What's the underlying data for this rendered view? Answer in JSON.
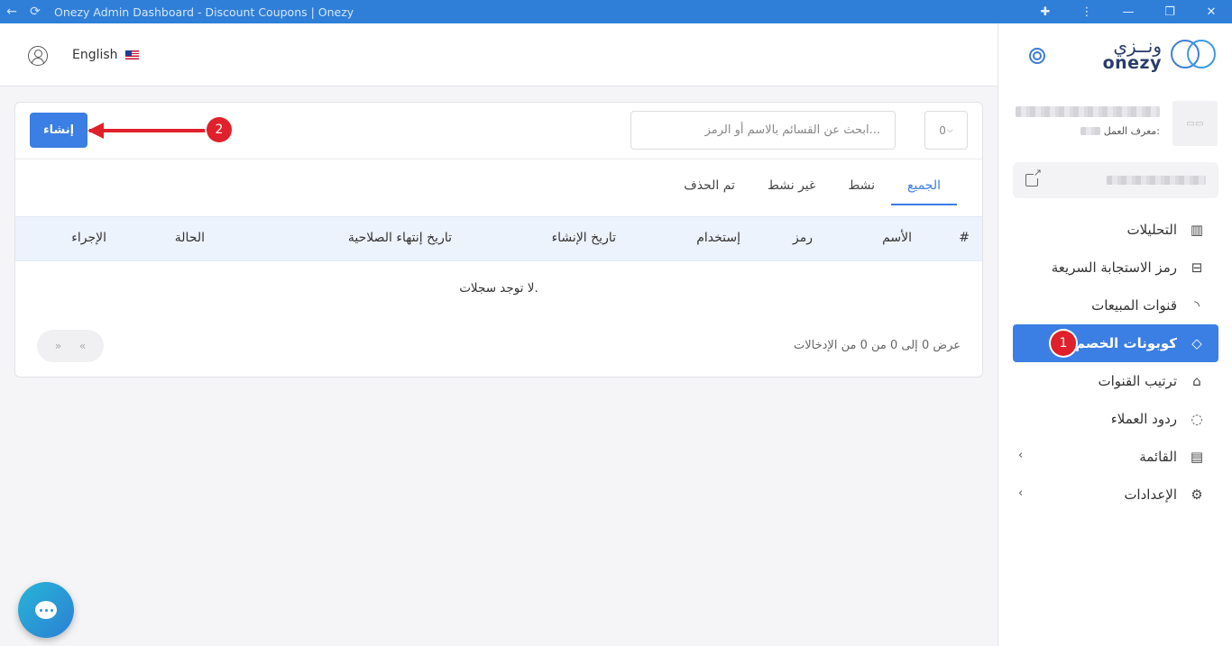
{
  "window": {
    "title": "Onezy Admin Dashboard - Discount Coupons | Onezy"
  },
  "header": {
    "language": "English"
  },
  "brand": {
    "name_ar": "ونــزي",
    "name_en": "onezy"
  },
  "business": {
    "id_label": "معرف العمل:"
  },
  "sidebar": {
    "items": [
      {
        "label": "التحليلات",
        "icon": "chart-icon"
      },
      {
        "label": "رمز الاستجابة السريعة",
        "icon": "qr-scan-icon"
      },
      {
        "label": "قنوات المبيعات",
        "icon": "rss-icon"
      },
      {
        "label": "كوبونات الخصم",
        "icon": "tag-icon",
        "active": true
      },
      {
        "label": "ترتيب القنوات",
        "icon": "store-icon"
      },
      {
        "label": "ردود العملاء",
        "icon": "chat-icon"
      },
      {
        "label": "القائمة",
        "icon": "clipboard-icon",
        "expandable": true
      },
      {
        "label": "الإعدادات",
        "icon": "gear-icon",
        "expandable": true
      }
    ]
  },
  "annotations": {
    "step1": "1",
    "step2": "2"
  },
  "toolbar": {
    "create_label": "إنشاء",
    "search_placeholder": "ابحث عن القسائم بالاسم أو الرمز...",
    "per_page": "0"
  },
  "tabs": [
    {
      "label": "الجميع",
      "active": true
    },
    {
      "label": "نشط"
    },
    {
      "label": "غير نشط"
    },
    {
      "label": "تم الحذف"
    }
  ],
  "table": {
    "columns": [
      "#",
      "الأسم",
      "رمز",
      "إستخدام",
      "تاريخ الإنشاء",
      "تاريخ إنتهاء الصلاحية",
      "الحالة",
      "الإجراء"
    ],
    "empty_message": "لا توجد سجلات.",
    "entries_info": "عرض 0 إلى 0 من 0 من الإدخالات",
    "pager": {
      "prev": "«",
      "next": "»"
    }
  },
  "colors": {
    "accent": "#3b7ee4",
    "annotation": "#e0202a",
    "titlebar": "#2f7fd8"
  }
}
